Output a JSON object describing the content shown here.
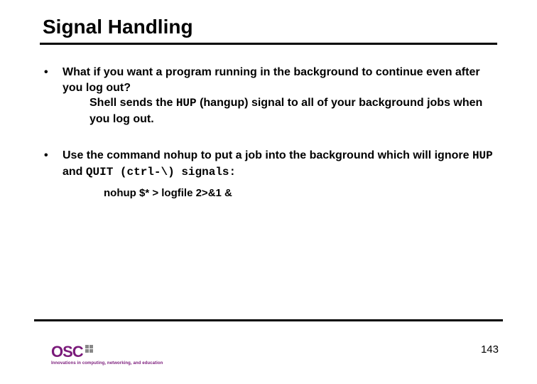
{
  "title": "Signal Handling",
  "bullets": [
    {
      "lead": "What if you want a program running in the background to continue even after you log out?",
      "sub_pre": "Shell sends the ",
      "sub_code": "HUP",
      "sub_post": " (hangup) signal to all of your background jobs when you log out."
    },
    {
      "b2_p1": "Use the command ",
      "b2_c1": "nohup",
      "b2_p2": " to put a job into the background which will ignore ",
      "b2_c2": "HUP",
      "b2_p3": " and ",
      "b2_c3": "QUIT (ctrl-\\)",
      "b2_p4": " signals:",
      "code": "nohup $* > logfile 2>&1 &"
    }
  ],
  "logo": {
    "text": "OSC",
    "tagline": "Innovations in computing, networking, and education"
  },
  "page": "143"
}
